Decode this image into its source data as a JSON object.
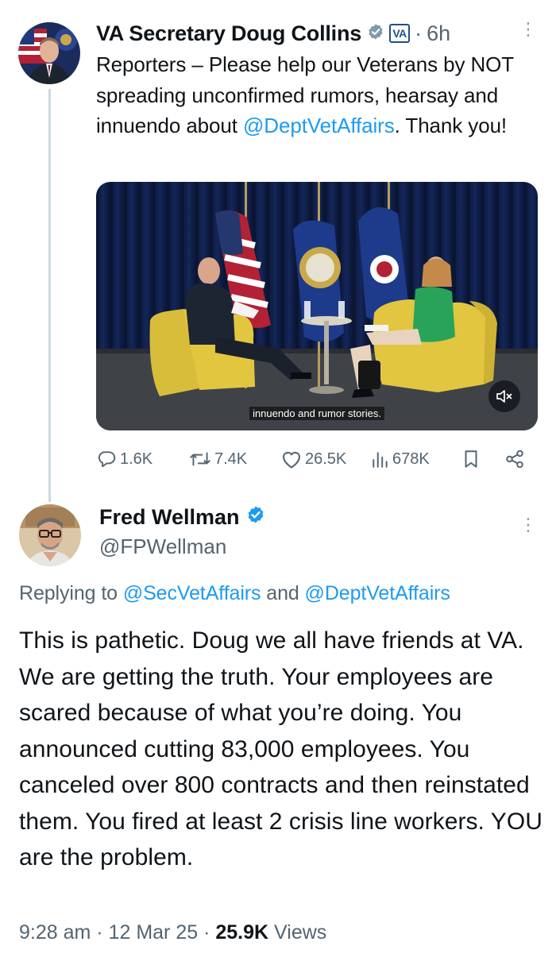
{
  "parent_tweet": {
    "author_name": "VA Secretary Doug Collins",
    "org_badge": "VA",
    "separator": "·",
    "time_ago": "6h",
    "text_before_mention": "Reporters – Please help our Veterans by NOT spreading unconfirmed rumors, hearsay and innuendo about ",
    "mention": "@DeptVetAffairs",
    "text_after_mention": ". Thank you!",
    "video_caption": "innuendo and rumor stories.",
    "actions": {
      "replies": "1.6K",
      "reposts": "7.4K",
      "likes": "26.5K",
      "views": "678K"
    }
  },
  "reply_tweet": {
    "author_name": "Fred Wellman",
    "handle": "@FPWellman",
    "replying_prefix": "Replying to ",
    "replying_mention_1": "@SecVetAffairs",
    "replying_and": " and ",
    "replying_mention_2": "@DeptVetAffairs",
    "text": "This is pathetic. Doug we all have friends at VA. We are getting the truth. Your employees are scared because of what you’re doing. You announced cutting 83,000 employees. You canceled over 800 contracts and then reinstated them. You fired at least 2 crisis line workers. YOU are the problem.",
    "time": "9:28 am",
    "date": "12 Mar 25",
    "separator": "·",
    "views_count": "25.9K",
    "views_label": "Views"
  },
  "colors": {
    "text_primary": "#0f1419",
    "text_secondary": "#536471",
    "link": "#1d9bf0",
    "verified_blue": "#1d9bf0",
    "verified_gray": "#829aab",
    "thread_line": "#cfd9de"
  },
  "icons": [
    "more-vertical-icon",
    "verified-gray-icon",
    "verified-blue-icon",
    "reply-icon",
    "repost-icon",
    "like-icon",
    "views-icon",
    "bookmark-icon",
    "share-icon",
    "mute-icon"
  ]
}
